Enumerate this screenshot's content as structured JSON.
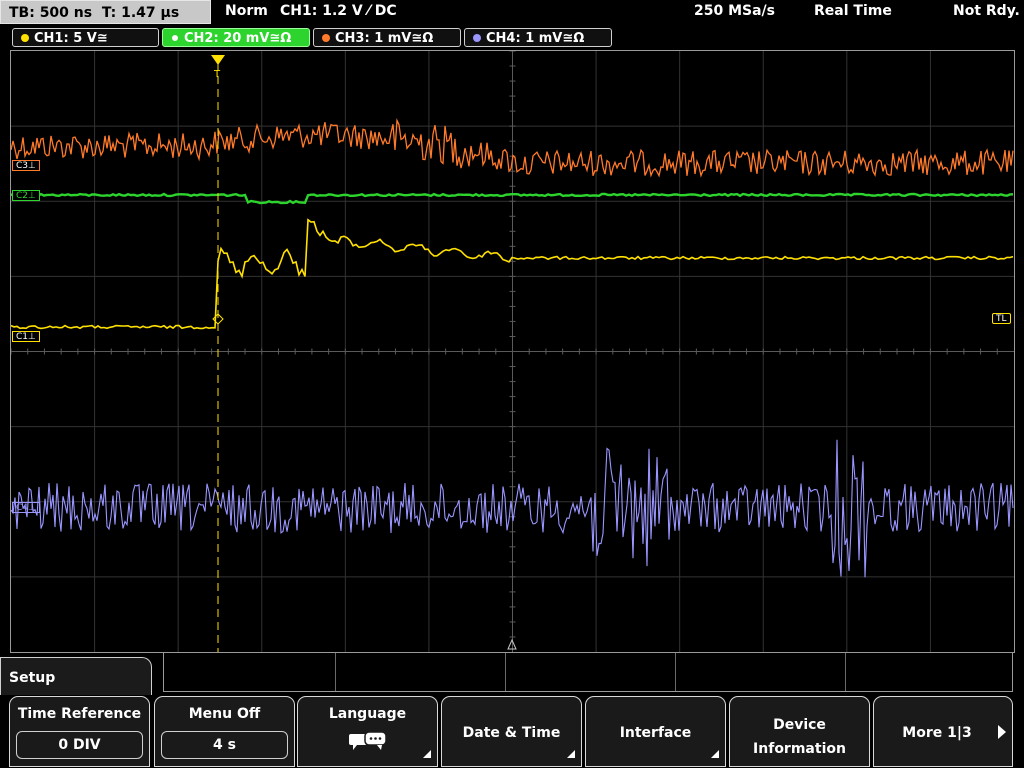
{
  "status": {
    "timebase": "TB: 500 ns",
    "trigger_time": "T: 1.47 µs",
    "mode": "Norm",
    "trigger": "CH1: 1.2 V ⁄ DC",
    "sample_rate": "250 MSa/s",
    "acq_mode": "Real Time",
    "state": "Not Rdy."
  },
  "channels": [
    {
      "label": "CH1: 5 V≅",
      "color": "#ffe000"
    },
    {
      "label": "CH2: 20 mV≅Ω",
      "color": "#2ed42e",
      "active": true
    },
    {
      "label": "CH3: 1 mV≅Ω",
      "color": "#ff7a2a"
    },
    {
      "label": "CH4: 1 mV≅Ω",
      "color": "#9a96ff"
    }
  ],
  "markers": {
    "c3": "C3⊥",
    "c2": "C2⊥",
    "c1": "C1⊥",
    "c4": "C4⊥",
    "trigger_level": "TL",
    "trigger_pos": "T"
  },
  "menu": {
    "tab": "Setup",
    "softkeys": [
      {
        "label": "Time Reference",
        "value": "0 DIV"
      },
      {
        "label": "Menu Off",
        "value": "4 s"
      },
      {
        "label": "Language",
        "icon": "speech-bubble-icon"
      },
      {
        "label": "Date & Time"
      },
      {
        "label": "Interface"
      },
      {
        "label_line1": "Device",
        "label_line2": "Information"
      },
      {
        "label": "More 1|3",
        "icon": "arrow-right-icon"
      }
    ]
  }
}
